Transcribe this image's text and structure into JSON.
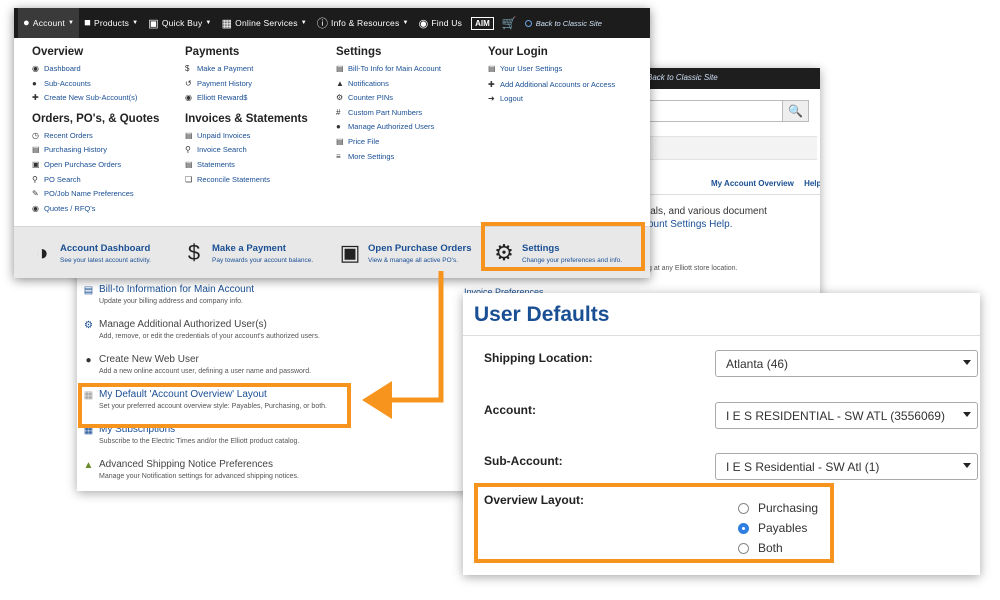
{
  "colors": {
    "accent": "#f7941d",
    "link": "#1a4f94",
    "navbar": "#1c1c1c",
    "radio_selected": "#2f7fe0"
  },
  "back_page": {
    "classic_link": "Back to Classic Site",
    "crumbs": [
      "My Account Overview",
      "Help"
    ],
    "intro_line1": "ials, and various document",
    "intro_line2": "ount Settings Help.",
    "intro_line3": "g at any Elliott store location.",
    "right_item": "Invoice Preferences",
    "settings": [
      {
        "icon": "bill-icon",
        "title": "Bill-to Information for Main Account",
        "desc": "Update your billing address and company info."
      },
      {
        "icon": "users-icon",
        "title": "Manage Additional Authorized User(s)",
        "desc": "Add, remove, or edit the credentials of your account's authorized users."
      },
      {
        "icon": "user-icon",
        "title": "Create New Web User",
        "desc": "Add a new online account user, defining a user name and password."
      },
      {
        "icon": "layout-icon",
        "title": "My Default 'Account Overview' Layout",
        "desc": "Set your preferred account overview style: Payables, Purchasing, or both."
      },
      {
        "icon": "subscriptions-icon",
        "title": "My Subscriptions",
        "desc": "Subscribe to the Electric Times and/or the Elliott product catalog."
      },
      {
        "icon": "shipping-icon",
        "title": "Advanced Shipping Notice Preferences",
        "desc": "Manage your Notification settings for advanced shipping notices."
      }
    ]
  },
  "nav": {
    "items": [
      {
        "icon": "account-icon",
        "label": "Account"
      },
      {
        "icon": "products-icon",
        "label": "Products"
      },
      {
        "icon": "quick-buy-icon",
        "label": "Quick Buy"
      },
      {
        "icon": "online-services-icon",
        "label": "Online Services"
      },
      {
        "icon": "info-icon",
        "label": "Info & Resources"
      },
      {
        "icon": "location-icon",
        "label": "Find Us"
      }
    ],
    "aim_logo": "AIM",
    "classic_link": "Back to Classic Site"
  },
  "menu": {
    "overview": {
      "heading": "Overview",
      "links": [
        "Dashboard",
        "Sub-Accounts",
        "Create New Sub-Account(s)"
      ]
    },
    "orders": {
      "heading": "Orders, PO's, & Quotes",
      "links": [
        "Recent Orders",
        "Purchasing History",
        "Open Purchase Orders",
        "PO Search",
        "PO/Job Name Preferences",
        "Quotes / RFQ's"
      ]
    },
    "payments": {
      "heading": "Payments",
      "links": [
        "Make a Payment",
        "Payment History",
        "Elliott Reward$"
      ]
    },
    "invoices": {
      "heading": "Invoices & Statements",
      "links": [
        "Unpaid Invoices",
        "Invoice Search",
        "Statements",
        "Reconcile Statements"
      ]
    },
    "settings": {
      "heading": "Settings",
      "links": [
        "Bill-To Info for Main Account",
        "Notifications",
        "Counter PINs",
        "Custom Part Numbers",
        "Manage Authorized Users",
        "Price File",
        "More Settings"
      ]
    },
    "login": {
      "heading": "Your Login",
      "links": [
        "Your User Settings",
        "Add Additional Accounts or Access",
        "Logout"
      ]
    }
  },
  "footer": [
    {
      "icon": "dashboard-icon",
      "title": "Account Dashboard",
      "desc": "See your latest account activity."
    },
    {
      "icon": "payment-icon",
      "title": "Make a Payment",
      "desc": "Pay towards your account balance."
    },
    {
      "icon": "open-po-icon",
      "title": "Open Purchase Orders",
      "desc": "View & manage all active PO's."
    },
    {
      "icon": "gear-icon",
      "title": "Settings",
      "desc": "Change your preferences and info."
    }
  ],
  "user_defaults": {
    "title": "User Defaults",
    "shipping_label": "Shipping Location:",
    "shipping_value": "Atlanta (46)",
    "account_label": "Account:",
    "account_value": "I E S RESIDENTIAL - SW ATL (3556069)",
    "subaccount_label": "Sub-Account:",
    "subaccount_value": "I E S Residential - SW Atl (1)",
    "overview_label": "Overview Layout:",
    "options": [
      "Purchasing",
      "Payables",
      "Both"
    ],
    "selected": "Payables"
  }
}
